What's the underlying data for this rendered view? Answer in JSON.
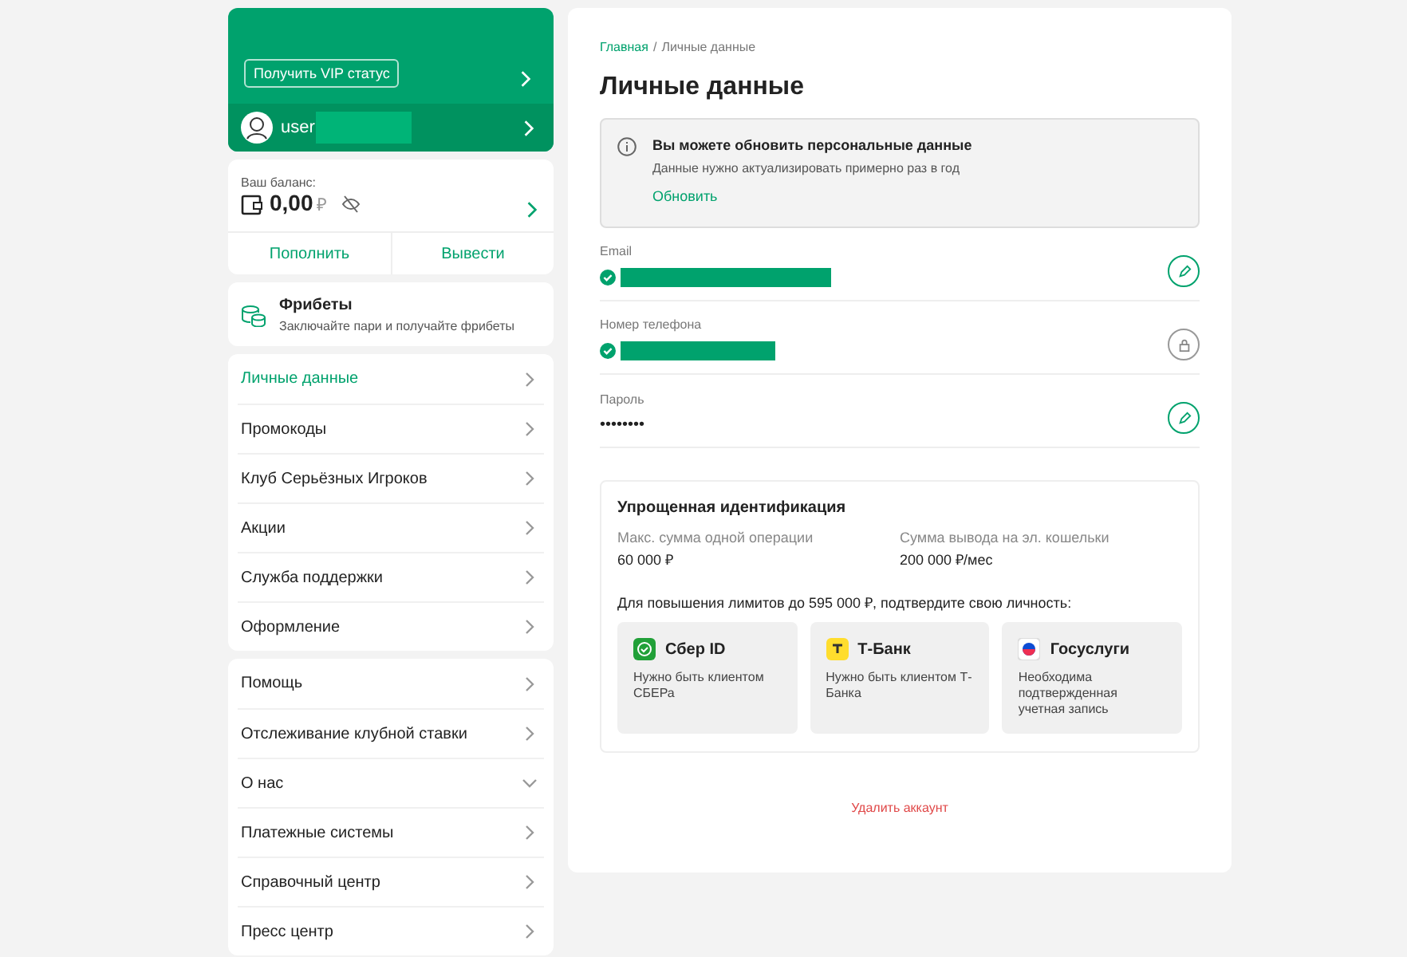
{
  "profile": {
    "vip_button": "Получить VIP статус",
    "username": "user",
    "username_redacted": true
  },
  "balance": {
    "label": "Ваш баланс:",
    "amount": "0,00",
    "currency": "₽",
    "deposit": "Пополнить",
    "withdraw": "Вывести"
  },
  "freebets": {
    "title": "Фрибеты",
    "subtitle": "Заключайте пари и получайте фрибеты"
  },
  "menu_groups": [
    [
      {
        "label": "Личные данные",
        "selected": true,
        "kind": "link"
      },
      {
        "label": "Промокоды",
        "selected": false,
        "kind": "link"
      },
      {
        "label": "Клуб Серьёзных Игроков",
        "selected": false,
        "kind": "link"
      },
      {
        "label": "Акции",
        "selected": false,
        "kind": "link"
      },
      {
        "label": "Служба поддержки",
        "selected": false,
        "kind": "link"
      },
      {
        "label": "Оформление",
        "selected": false,
        "kind": "link"
      }
    ],
    [
      {
        "label": "Помощь",
        "selected": false,
        "kind": "link"
      },
      {
        "label": "Отслеживание клубной ставки",
        "selected": false,
        "kind": "link"
      },
      {
        "label": "О нас",
        "selected": false,
        "kind": "dropdown"
      },
      {
        "label": "Платежные системы",
        "selected": false,
        "kind": "link"
      },
      {
        "label": "Справочный центр",
        "selected": false,
        "kind": "link"
      },
      {
        "label": "Пресс центр",
        "selected": false,
        "kind": "link"
      }
    ]
  ],
  "breadcrumb_separator": "/",
  "breadcrumbs": [
    {
      "label": "Главная",
      "kind": "link"
    },
    {
      "label": "Личные данные",
      "kind": "current"
    }
  ],
  "title": "Личные данные",
  "notice": {
    "title": "Вы можете обновить персональные данные",
    "text": "Данные нужно актуализировать примерно раз в год",
    "action": "Обновить"
  },
  "fields": [
    {
      "label": "Email",
      "kind": "redacted",
      "verified": true,
      "locked": false
    },
    {
      "label": "Номер телефона",
      "kind": "redacted",
      "verified": true,
      "locked": true
    },
    {
      "label": "Пароль",
      "kind": "text",
      "value": "••••••••",
      "verified": false,
      "locked": false
    }
  ],
  "identification": {
    "title": "Упрощенная идентификация",
    "limits": [
      {
        "label": "Макс. сумма одной операции",
        "value": "60 000 ₽"
      },
      {
        "label": "Сумма вывода на эл. кошельки",
        "value": "200 000 ₽/мес"
      }
    ],
    "prompt": "Для повышения лимитов до 595 000 ₽, подтвердите свою личность:",
    "providers": [
      {
        "name": "Сбер ID",
        "text": "Нужно быть клиентом СБЕРа",
        "kind": "sber"
      },
      {
        "name": "Т-Банк",
        "text": "Нужно быть клиентом Т-Банка",
        "kind": "tbank"
      },
      {
        "name": "Госуслуги",
        "text": "Необходима подтвержденная учетная запись",
        "kind": "gosuslugi"
      }
    ]
  },
  "delete_link": "Удалить аккаунт"
}
